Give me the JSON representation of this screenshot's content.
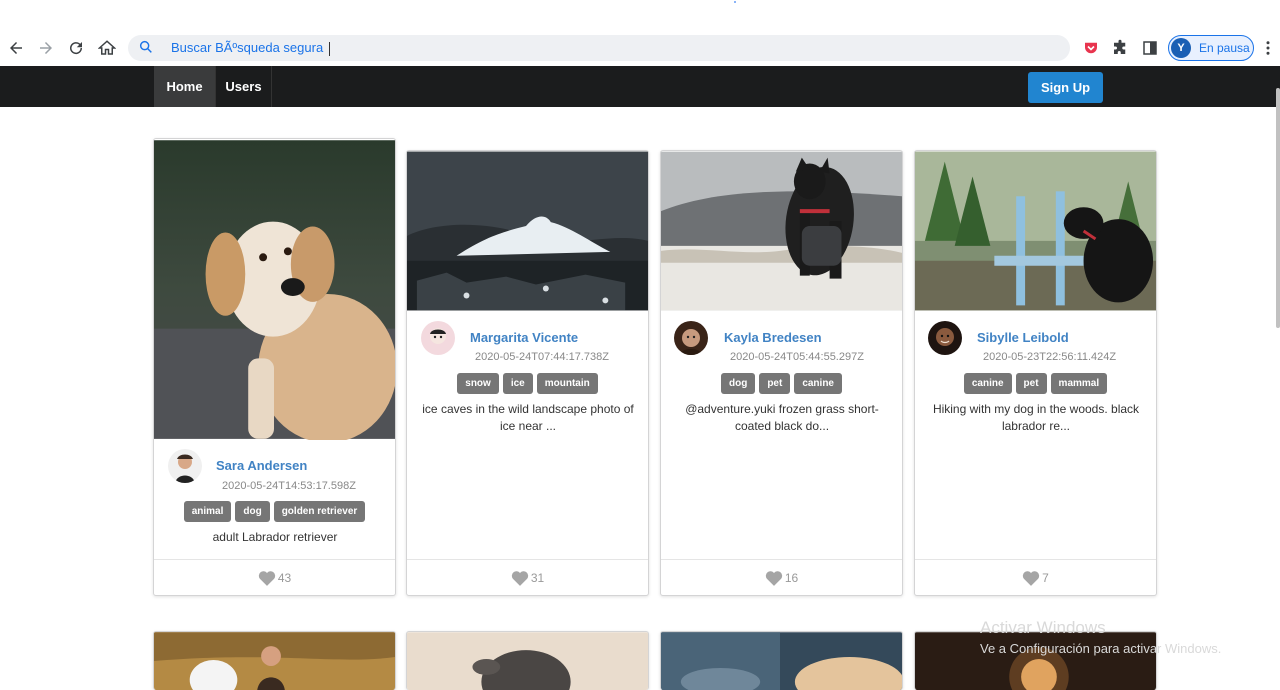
{
  "browser": {
    "omnibox_text": "Buscar BÃºsqueda segura",
    "profile_initial": "Y",
    "profile_status": "En pausa"
  },
  "nav": {
    "home": "Home",
    "users": "Users",
    "signup": "Sign Up"
  },
  "cards": [
    {
      "author": "Sara Andersen",
      "date": "2020-05-24T14:53:17.598Z",
      "tags": [
        "animal",
        "dog",
        "golden retriever"
      ],
      "description": "adult Labrador retriever",
      "likes": "43"
    },
    {
      "author": "Margarita Vicente",
      "date": "2020-05-24T07:44:17.738Z",
      "tags": [
        "snow",
        "ice",
        "mountain"
      ],
      "description": "ice caves in the wild landscape photo of ice near ...",
      "likes": "31"
    },
    {
      "author": "Kayla Bredesen",
      "date": "2020-05-24T05:44:55.297Z",
      "tags": [
        "dog",
        "pet",
        "canine"
      ],
      "description": "@adventure.yuki frozen grass short-coated black do...",
      "likes": "16"
    },
    {
      "author": "Sibylle Leibold",
      "date": "2020-05-23T22:56:11.424Z",
      "tags": [
        "canine",
        "pet",
        "mammal"
      ],
      "description": "Hiking with my dog in the woods. black labrador re...",
      "likes": "7"
    }
  ],
  "watermark": {
    "line1": "Activar Windows",
    "line2": "Ve a Configuración para activar Windows."
  }
}
